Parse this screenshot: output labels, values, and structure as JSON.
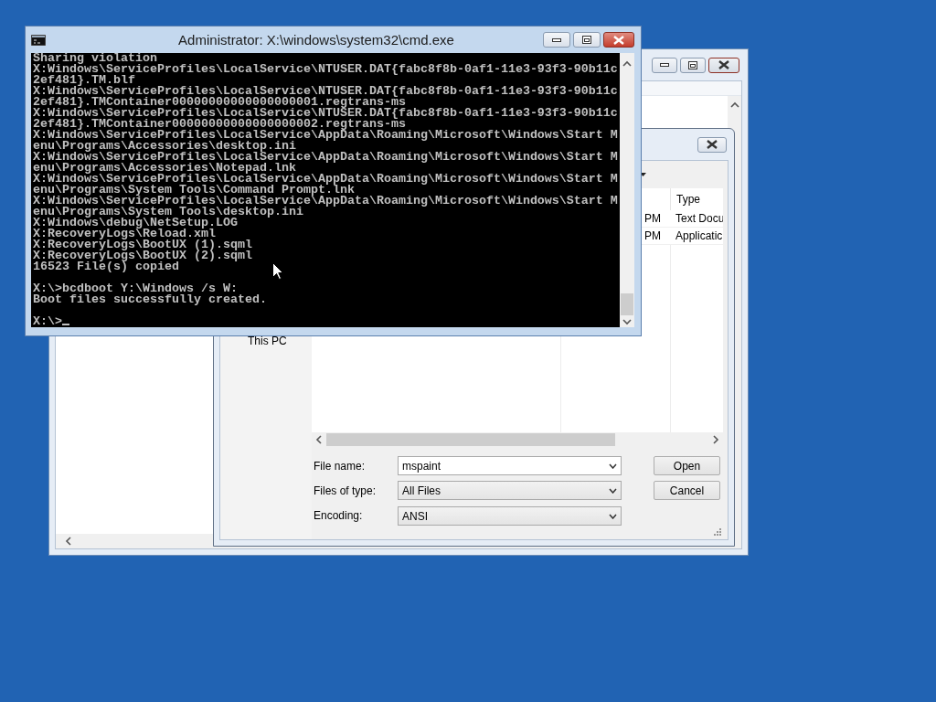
{
  "console_window": {
    "title": "Administrator: X:\\windows\\system32\\cmd.exe",
    "blocks": [
      [
        "Sharing violation",
        "X:Windows\\ServiceProfiles\\LocalService\\NTUSER.DAT{fabc8f8b-0af1-11e3-93f3-90b11c",
        "2ef481}.TM.blf",
        "X:Windows\\ServiceProfiles\\LocalService\\NTUSER.DAT{fabc8f8b-0af1-11e3-93f3-90b11c",
        "2ef481}.TMContainer00000000000000000001.regtrans-ms",
        "X:Windows\\ServiceProfiles\\LocalService\\NTUSER.DAT{fabc8f8b-0af1-11e3-93f3-90b11c",
        "2ef481}.TMContainer00000000000000000002.regtrans-ms",
        "X:Windows\\ServiceProfiles\\LocalService\\AppData\\Roaming\\Microsoft\\Windows\\Start M",
        "enu\\Programs\\Accessories\\desktop.ini",
        "X:Windows\\ServiceProfiles\\LocalService\\AppData\\Roaming\\Microsoft\\Windows\\Start M",
        "enu\\Programs\\Accessories\\Notepad.lnk",
        "X:Windows\\ServiceProfiles\\LocalService\\AppData\\Roaming\\Microsoft\\Windows\\Start M",
        "enu\\Programs\\System Tools\\Command Prompt.lnk",
        "X:Windows\\ServiceProfiles\\LocalService\\AppData\\Roaming\\Microsoft\\Windows\\Start M",
        "enu\\Programs\\System Tools\\desktop.ini",
        "X:Windows\\debug\\NetSetup.LOG",
        "X:RecoveryLogs\\Reload.xml",
        "X:RecoveryLogs\\BootUX (1).sqml",
        "X:RecoveryLogs\\BootUX (2).sqml",
        "16523 File(s) copied"
      ],
      [
        "X:\\>bcdboot Y:\\Windows /s W:",
        "Boot files successfully created."
      ],
      [
        "X:\\>"
      ]
    ]
  },
  "open_dialog": {
    "nav_items": [
      "This PC"
    ],
    "columns": [
      "",
      "Type"
    ],
    "rows": [
      {
        "cells": [
          "PM",
          "Text Docu"
        ]
      },
      {
        "cells": [
          "PM",
          "Applicatic"
        ]
      }
    ],
    "fields": [
      {
        "kind": "combo-input",
        "label": "File name:",
        "value": "mspaint"
      },
      {
        "kind": "dropdown",
        "label": "Files of type:",
        "value": "All Files"
      },
      {
        "kind": "dropdown",
        "label": "Encoding:",
        "value": "ANSI"
      }
    ],
    "buttons": [
      "Open",
      "Cancel"
    ]
  }
}
